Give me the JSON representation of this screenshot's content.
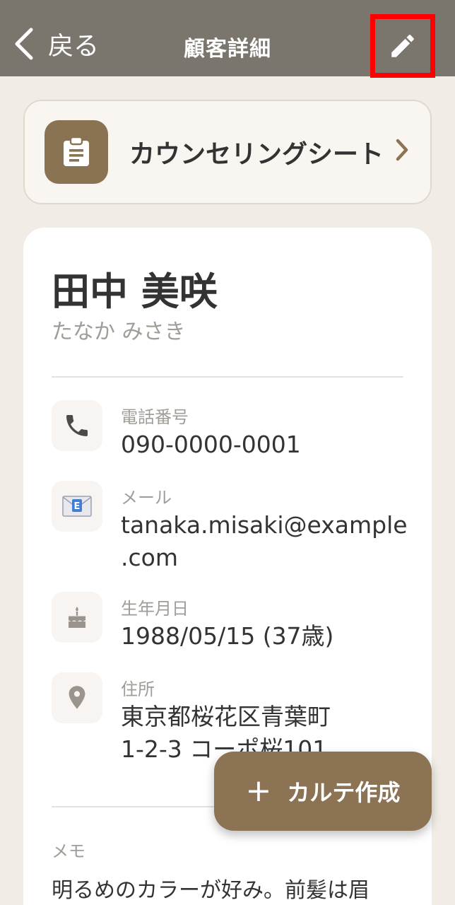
{
  "header": {
    "back_label": "戻る",
    "title": "顧客詳細",
    "edit_icon": "pencil-icon"
  },
  "counseling": {
    "label": "カウンセリングシート",
    "icon": "clipboard-icon"
  },
  "customer": {
    "name": "田中 美咲",
    "kana": "たなか みさき"
  },
  "info": {
    "phone": {
      "label": "電話番号",
      "value": "090-0000-0001"
    },
    "email": {
      "label": "メール",
      "value_line1": "tanaka.misaki@example",
      "value_line2": ".com"
    },
    "birthday": {
      "label": "生年月日",
      "value": "1988/05/15 (37歳)"
    },
    "address": {
      "label": "住所",
      "value_line1": "東京都桜花区青葉町",
      "value_line2": "1-2-3 コーポ桜101"
    }
  },
  "memo": {
    "label": "メモ",
    "text": "明るめのカラーが好み。前髪は眉"
  },
  "fab": {
    "plus": "+",
    "label": "カルテ作成"
  },
  "colors": {
    "header_bg": "#7b766d",
    "accent_brown": "#8b7354",
    "page_bg": "#f1ede6",
    "highlight_red": "#ff0000"
  }
}
